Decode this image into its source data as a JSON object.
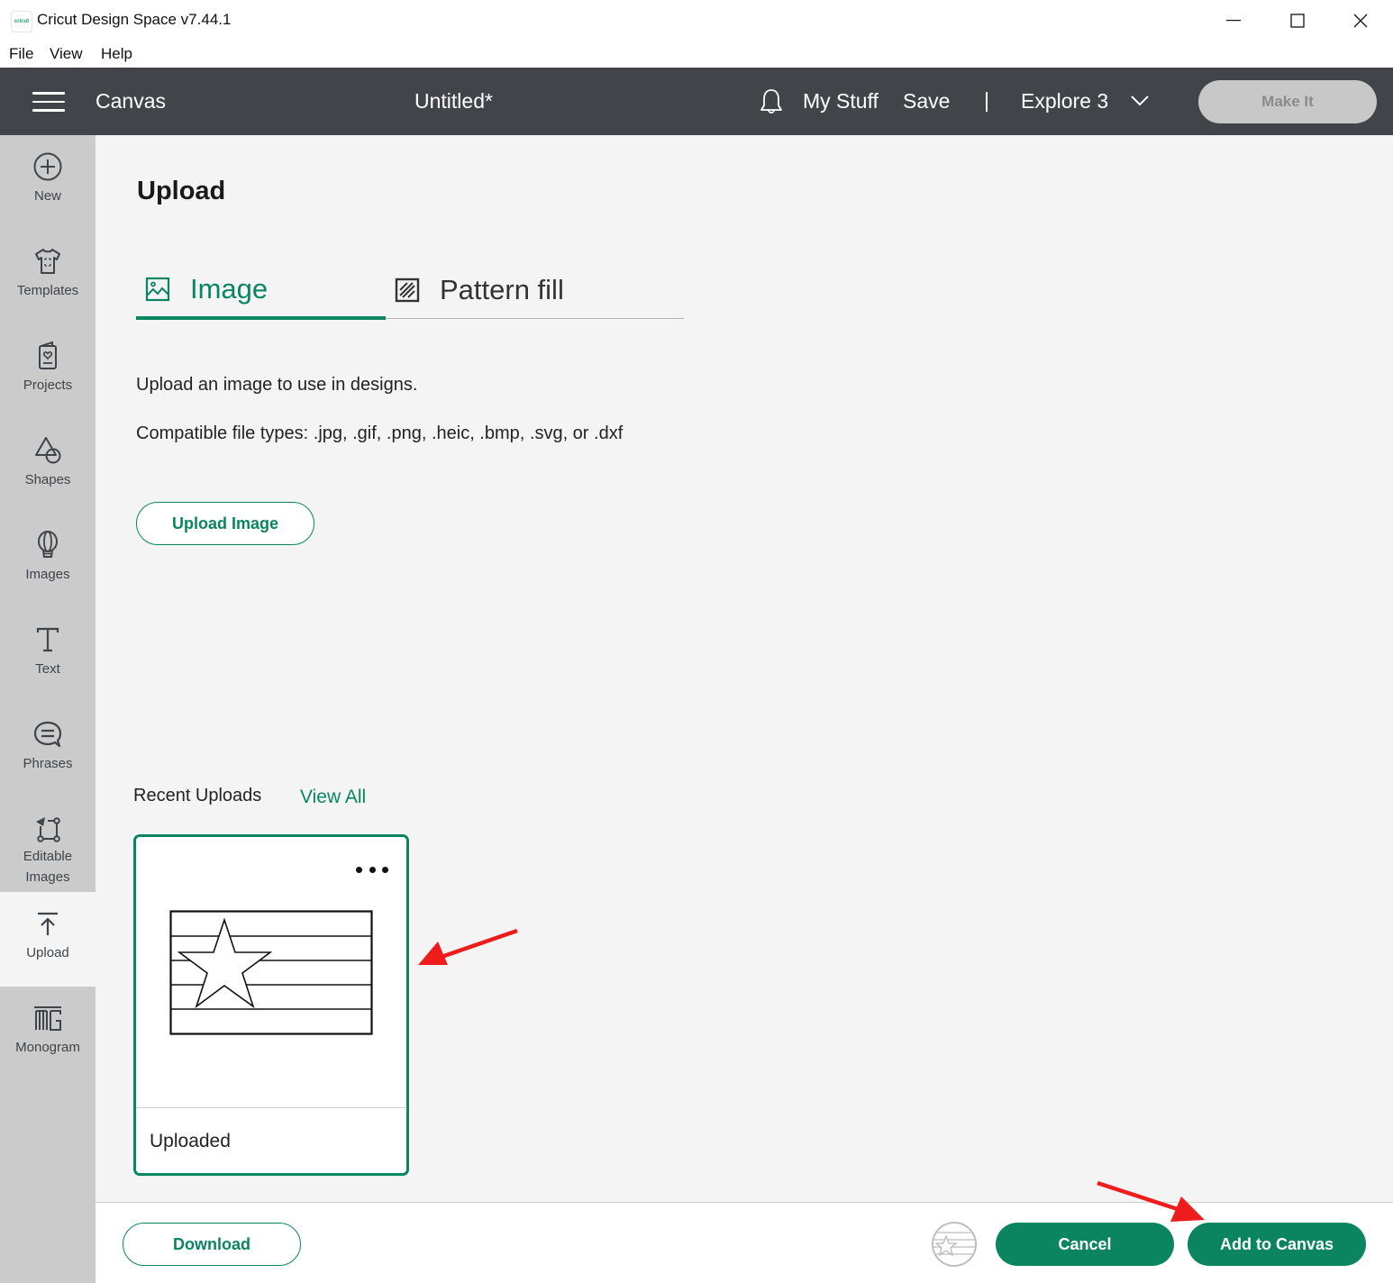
{
  "window": {
    "logo_text": "cricut",
    "title": "Cricut Design Space  v7.44.1",
    "controls": [
      "minimize",
      "maximize",
      "close"
    ]
  },
  "menubar": {
    "items": [
      "File",
      "View",
      "Help"
    ]
  },
  "header": {
    "section": "Canvas",
    "document_title": "Untitled*",
    "my_stuff": "My Stuff",
    "save": "Save",
    "machine": "Explore 3",
    "make_it": "Make It"
  },
  "sidebar": {
    "items": [
      {
        "label": "New",
        "icon": "plus-circle-icon"
      },
      {
        "label": "Templates",
        "icon": "tshirt-icon"
      },
      {
        "label": "Projects",
        "icon": "card-heart-icon"
      },
      {
        "label": "Shapes",
        "icon": "shapes-icon"
      },
      {
        "label": "Images",
        "icon": "balloon-icon"
      },
      {
        "label": "Text",
        "icon": "text-t-icon"
      },
      {
        "label": "Phrases",
        "icon": "speech-bubble-icon"
      },
      {
        "label": "Editable Images",
        "icon": "editable-image-icon"
      },
      {
        "label": "Upload",
        "icon": "upload-arrow-icon",
        "active": true
      },
      {
        "label": "Monogram",
        "icon": "monogram-icon"
      }
    ]
  },
  "panel": {
    "title": "Upload",
    "tabs": [
      {
        "label": "Image",
        "icon": "image-icon",
        "active": true
      },
      {
        "label": "Pattern fill",
        "icon": "pattern-fill-icon",
        "active": false
      }
    ],
    "description": "Upload an image to use in designs.",
    "file_types": "Compatible file types: .jpg, .gif, .png, .heic, .bmp, .svg, or .dxf",
    "upload_button": "Upload Image",
    "recent_uploads_label": "Recent Uploads",
    "view_all": "View All",
    "uploads": [
      {
        "label": "Uploaded",
        "thumbnail": "flag-star-stripes",
        "selected": true
      }
    ]
  },
  "footer": {
    "download": "Download",
    "cancel": "Cancel",
    "add_to_canvas": "Add to Canvas"
  },
  "colors": {
    "accent": "#0a8560",
    "header_bg": "#414549",
    "sidebar_bg": "#cbcbcb",
    "panel_bg": "#f4f4f4",
    "annotation_arrow": "#ee1c1c"
  }
}
